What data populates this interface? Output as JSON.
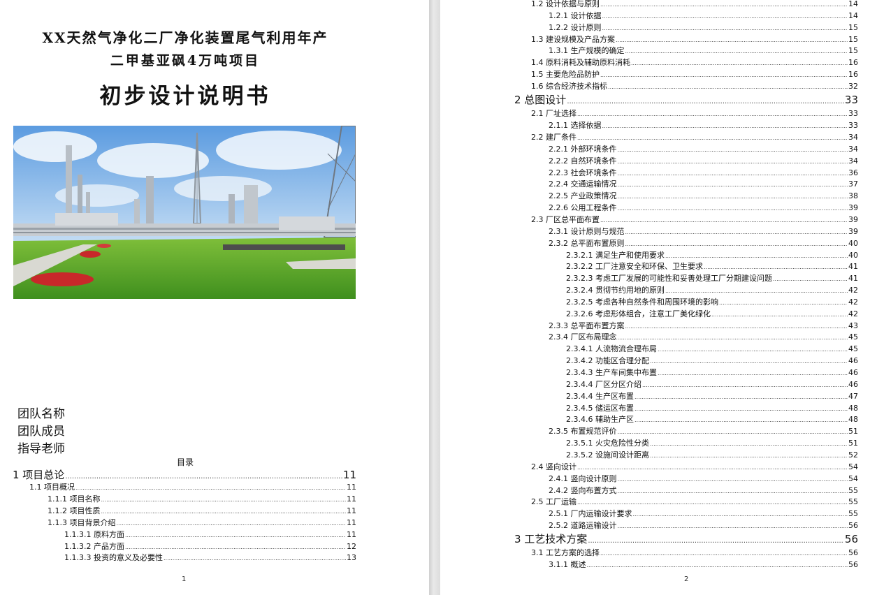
{
  "cover": {
    "title_line1": "XX天然气净化二厂净化装置尾气利用年产",
    "title_line2": "二甲基亚砜4万吨项目",
    "title_main": "初步设计说明书",
    "team_name": "团队名称",
    "team_members": "团队成员",
    "advisor": "指导老师",
    "toc_heading": "目录",
    "page_number": "1"
  },
  "toc_page1": [
    {
      "label": "1 项目总论",
      "page": "11",
      "level": 0
    },
    {
      "label": "1.1 项目概况",
      "page": "11",
      "level": 1
    },
    {
      "label": "1.1.1 项目名称",
      "page": "11",
      "level": 2
    },
    {
      "label": "1.1.2 项目性质",
      "page": "11",
      "level": 2
    },
    {
      "label": "1.1.3 项目背景介绍",
      "page": "11",
      "level": 2
    },
    {
      "label": "1.1.3.1 原料方面",
      "page": "11",
      "level": 3
    },
    {
      "label": "1.1.3.2 产品方面",
      "page": "12",
      "level": 3
    },
    {
      "label": "1.1.3.3 投资的意义及必要性",
      "page": "13",
      "level": 3
    }
  ],
  "toc_page2": [
    {
      "label": "1.2 设计依据与原则",
      "page": "14",
      "level": 1
    },
    {
      "label": "1.2.1 设计依据",
      "page": "14",
      "level": 2
    },
    {
      "label": "1.2.2 设计原则",
      "page": "15",
      "level": 2
    },
    {
      "label": "1.3 建设规模及产品方案",
      "page": "15",
      "level": 1
    },
    {
      "label": "1.3.1 生产规模的确定",
      "page": "15",
      "level": 2
    },
    {
      "label": "1.4 原料消耗及辅助原料消耗",
      "page": "16",
      "level": 1
    },
    {
      "label": "1.5 主要危险品防护",
      "page": "16",
      "level": 1
    },
    {
      "label": "1.6 综合经济技术指标",
      "page": "32",
      "level": 1
    },
    {
      "label": "2 总图设计",
      "page": "33",
      "level": 0
    },
    {
      "label": "2.1 厂址选择",
      "page": "33",
      "level": 1
    },
    {
      "label": "2.1.1 选择依据",
      "page": "33",
      "level": 2
    },
    {
      "label": "2.2 建厂条件",
      "page": "34",
      "level": 1
    },
    {
      "label": "2.2.1 外部环境条件",
      "page": "34",
      "level": 2
    },
    {
      "label": "2.2.2 自然环境条件",
      "page": "34",
      "level": 2
    },
    {
      "label": "2.2.3 社会环境条件",
      "page": "36",
      "level": 2
    },
    {
      "label": "2.2.4 交通运输情况",
      "page": "37",
      "level": 2
    },
    {
      "label": "2.2.5 产业政策情况",
      "page": "38",
      "level": 2
    },
    {
      "label": "2.2.6 公用工程条件",
      "page": "39",
      "level": 2
    },
    {
      "label": "2.3 厂区总平面布置",
      "page": "39",
      "level": 1
    },
    {
      "label": "2.3.1 设计原则与规范",
      "page": "39",
      "level": 2
    },
    {
      "label": "2.3.2 总平面布置原则",
      "page": "40",
      "level": 2
    },
    {
      "label": "2.3.2.1 满足生产和使用要求",
      "page": "40",
      "level": 3
    },
    {
      "label": "2.3.2.2 工厂注意安全和环保、卫生要求",
      "page": "41",
      "level": 3
    },
    {
      "label": "2.3.2.3 考虑工厂发展的可能性和妥善处理工厂分期建设问题",
      "page": "41",
      "level": 3
    },
    {
      "label": "2.3.2.4 贯彻节约用地的原则",
      "page": "42",
      "level": 3
    },
    {
      "label": "2.3.2.5 考虑各种自然条件和周围环境的影响",
      "page": "42",
      "level": 3
    },
    {
      "label": "2.3.2.6 考虑形体组合，注意工厂美化绿化",
      "page": "42",
      "level": 3
    },
    {
      "label": "2.3.3 总平面布置方案",
      "page": "43",
      "level": 2
    },
    {
      "label": "2.3.4 厂区布局理念",
      "page": "45",
      "level": 2
    },
    {
      "label": "2.3.4.1 人流物流合理布局",
      "page": "45",
      "level": 3
    },
    {
      "label": "2.3.4.2 功能区合理分配",
      "page": "46",
      "level": 3
    },
    {
      "label": "2.3.4.3 生产车间集中布置",
      "page": "46",
      "level": 3
    },
    {
      "label": "2.3.4.4 厂区分区介绍",
      "page": "46",
      "level": 3
    },
    {
      "label": "2.3.4.4 生产区布置",
      "page": "47",
      "level": 3
    },
    {
      "label": "2.3.4.5 储运区布置",
      "page": "48",
      "level": 3
    },
    {
      "label": "2.3.4.6 辅助生产区",
      "page": "48",
      "level": 3
    },
    {
      "label": "2.3.5 布置规范评价",
      "page": "51",
      "level": 2
    },
    {
      "label": "2.3.5.1 火灾危险性分类",
      "page": "51",
      "level": 3
    },
    {
      "label": "2.3.5.2 设施间设计距离",
      "page": "52",
      "level": 3
    },
    {
      "label": "2.4 竖向设计",
      "page": "54",
      "level": 1
    },
    {
      "label": "2.4.1 竖向设计原则",
      "page": "54",
      "level": 2
    },
    {
      "label": "2.4.2 竖向布置方式",
      "page": "55",
      "level": 2
    },
    {
      "label": "2.5 工厂运输",
      "page": "55",
      "level": 1
    },
    {
      "label": "2.5.1 厂内运输设计要求",
      "page": "55",
      "level": 2
    },
    {
      "label": "2.5.2 道路运输设计",
      "page": "56",
      "level": 2
    },
    {
      "label": "3 工艺技术方案",
      "page": "56",
      "level": 0
    },
    {
      "label": "3.1 工艺方案的选择",
      "page": "56",
      "level": 1
    },
    {
      "label": "3.1.1 概述",
      "page": "56",
      "level": 2
    }
  ],
  "page2_number": "2"
}
